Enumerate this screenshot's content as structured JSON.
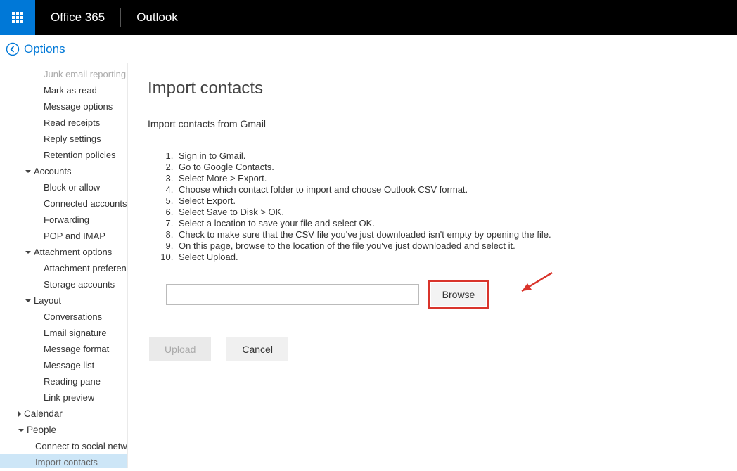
{
  "header": {
    "brand": "Office 365",
    "app": "Outlook"
  },
  "options_label": "Options",
  "sidebar": {
    "mail_items": [
      "Junk email reporting",
      "Mark as read",
      "Message options",
      "Read receipts",
      "Reply settings",
      "Retention policies"
    ],
    "accounts_label": "Accounts",
    "accounts_items": [
      "Block or allow",
      "Connected accounts",
      "Forwarding",
      "POP and IMAP"
    ],
    "attachment_label": "Attachment options",
    "attachment_items": [
      "Attachment preference",
      "Storage accounts"
    ],
    "layout_label": "Layout",
    "layout_items": [
      "Conversations",
      "Email signature",
      "Message format",
      "Message list",
      "Reading pane",
      "Link preview"
    ],
    "calendar_label": "Calendar",
    "people_label": "People",
    "people_items": [
      "Connect to social networks",
      "Import contacts"
    ]
  },
  "main": {
    "title": "Import contacts",
    "subtitle": "Import contacts from Gmail",
    "steps": [
      "Sign in to Gmail.",
      "Go to Google Contacts.",
      "Select More > Export.",
      "Choose which contact folder to import and choose Outlook CSV format.",
      "Select Export.",
      "Select Save to Disk > OK.",
      "Select a location to save your file and select OK.",
      "Check to make sure that the CSV file you've just downloaded isn't empty by opening the file.",
      "On this page, browse to the location of the file you've just downloaded and select it.",
      "Select Upload."
    ],
    "file_value": "",
    "browse_label": "Browse",
    "upload_label": "Upload",
    "cancel_label": "Cancel"
  }
}
